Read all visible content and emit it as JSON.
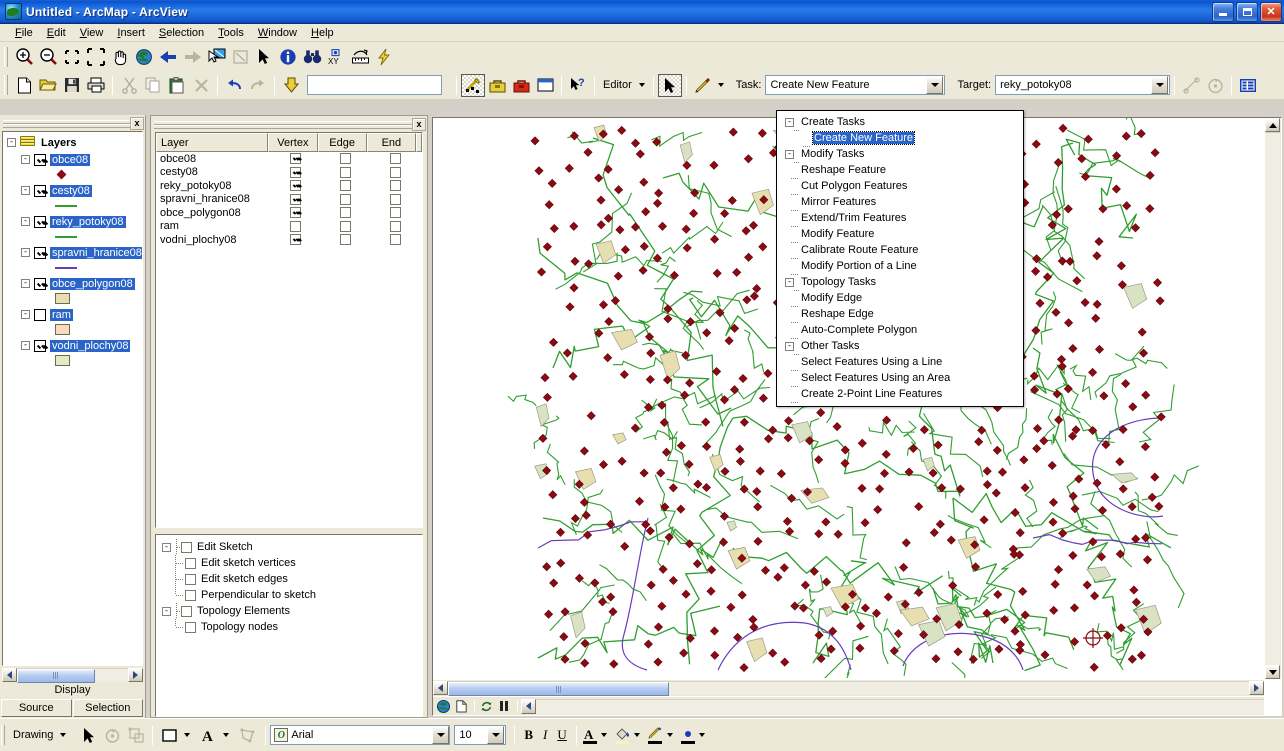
{
  "window": {
    "title": "Untitled - ArcMap - ArcView",
    "app_icon": "arcmap-globe-icon",
    "minimize": "minimize-button",
    "restore": "restore-button",
    "close": "close-button"
  },
  "menu": [
    {
      "label": "File",
      "accel": "F"
    },
    {
      "label": "Edit",
      "accel": "E"
    },
    {
      "label": "View",
      "accel": "V"
    },
    {
      "label": "Insert",
      "accel": "I"
    },
    {
      "label": "Selection",
      "accel": "S"
    },
    {
      "label": "Tools",
      "accel": "T"
    },
    {
      "label": "Window",
      "accel": "W"
    },
    {
      "label": "Help",
      "accel": "H"
    }
  ],
  "tools_toolbar": [
    {
      "name": "zoom-in-icon",
      "title": "Zoom In"
    },
    {
      "name": "zoom-out-icon",
      "title": "Zoom Out"
    },
    {
      "name": "fixed-zoom-in-icon",
      "title": "Fixed Zoom In"
    },
    {
      "name": "fixed-zoom-out-icon",
      "title": "Fixed Zoom Out"
    },
    {
      "name": "pan-hand-icon",
      "title": "Pan"
    },
    {
      "name": "full-extent-globe-icon",
      "title": "Full Extent"
    },
    {
      "name": "back-extent-icon",
      "title": "Go Back To Previous Extent"
    },
    {
      "name": "forward-extent-icon",
      "title": "Go To Next Extent"
    },
    {
      "name": "select-features-icon",
      "title": "Select Features"
    },
    {
      "name": "select-elements-icon",
      "title": "Select Elements"
    },
    {
      "name": "pointer-icon",
      "title": "Select Elements"
    },
    {
      "name": "identify-icon",
      "title": "Identify"
    },
    {
      "name": "find-binoculars-icon",
      "title": "Find"
    },
    {
      "name": "go-to-xy-icon",
      "title": "Go To XY"
    },
    {
      "name": "measure-icon",
      "title": "Measure"
    },
    {
      "name": "hyperlink-lightning-icon",
      "title": "Hyperlink"
    }
  ],
  "standard_toolbar": [
    {
      "name": "new-document-icon",
      "title": "New"
    },
    {
      "name": "open-folder-icon",
      "title": "Open"
    },
    {
      "name": "save-diskette-icon",
      "title": "Save"
    },
    {
      "name": "print-icon",
      "title": "Print"
    },
    {
      "name": "cut-scissors-icon",
      "title": "Cut"
    },
    {
      "name": "copy-icon",
      "title": "Copy"
    },
    {
      "name": "paste-clipboard-icon",
      "title": "Paste"
    },
    {
      "name": "delete-x-icon",
      "title": "Delete"
    },
    {
      "name": "undo-arrow-icon",
      "title": "Undo"
    },
    {
      "name": "redo-arrow-icon",
      "title": "Redo"
    },
    {
      "name": "add-data-icon",
      "title": "Add Data"
    }
  ],
  "scale_box": {
    "value": "",
    "placeholder": ""
  },
  "editor_toolbar": {
    "sketch_tool_icon": "sketch-tool-icon",
    "toolbox_icon": "editor-toolbox-icon",
    "toolbox_red_icon": "editor-red-toolbox-icon",
    "attributes_icon": "attributes-window-icon",
    "whats_this_icon": "whats-this-pointer-icon",
    "editor_menu_label": "Editor",
    "edit_tool_icon": "edit-pointer-icon",
    "sketch_pencil_icon": "sketch-pencil-icon",
    "task_label": "Task:",
    "task_value": "Create New Feature",
    "target_label": "Target:",
    "target_value": "reky_potoky08",
    "split_tool_icon": "split-tool-icon",
    "rotate_tool_icon": "rotate-tool-icon",
    "attribute_table_icon": "attribute-table-icon"
  },
  "task_dropdown": {
    "groups": [
      {
        "label": "Create Tasks",
        "expander": "-",
        "items": [
          {
            "label": "Create New Feature",
            "selected": true
          }
        ]
      },
      {
        "label": "Modify Tasks",
        "expander": "-",
        "items": [
          {
            "label": "Reshape Feature",
            "selected": false
          },
          {
            "label": "Cut Polygon Features",
            "selected": false
          },
          {
            "label": "Mirror Features",
            "selected": false
          },
          {
            "label": "Extend/Trim Features",
            "selected": false
          },
          {
            "label": "Modify Feature",
            "selected": false
          },
          {
            "label": "Calibrate Route Feature",
            "selected": false
          },
          {
            "label": "Modify Portion of a Line",
            "selected": false
          }
        ]
      },
      {
        "label": "Topology Tasks",
        "expander": "-",
        "items": [
          {
            "label": "Modify Edge",
            "selected": false
          },
          {
            "label": "Reshape Edge",
            "selected": false
          },
          {
            "label": "Auto-Complete Polygon",
            "selected": false
          }
        ]
      },
      {
        "label": "Other Tasks",
        "expander": "-",
        "items": [
          {
            "label": "Select Features Using a Line",
            "selected": false
          },
          {
            "label": "Select Features Using an Area",
            "selected": false
          },
          {
            "label": "Create 2-Point Line Features",
            "selected": false
          }
        ]
      }
    ]
  },
  "toc": {
    "close_label": "x",
    "root_label": "Layers",
    "root_expander": "-",
    "layers": [
      {
        "name": "obce08",
        "checked": true,
        "expander": "-",
        "symbol": {
          "kind": "diamond",
          "color": "#8b0a13"
        }
      },
      {
        "name": "cesty08",
        "checked": true,
        "expander": "-",
        "symbol": {
          "kind": "line",
          "color": "#2f9e2f"
        }
      },
      {
        "name": "reky_potoky08",
        "checked": true,
        "expander": "-",
        "symbol": {
          "kind": "line",
          "color": "#2f9e2f"
        }
      },
      {
        "name": "spravni_hranice08",
        "checked": true,
        "expander": "-",
        "symbol": {
          "kind": "line",
          "color": "#6a3bbf"
        }
      },
      {
        "name": "obce_polygon08",
        "checked": true,
        "expander": "-",
        "symbol": {
          "kind": "square",
          "color": "#e8dfb0"
        }
      },
      {
        "name": "ram",
        "checked": false,
        "expander": "-",
        "symbol": {
          "kind": "square",
          "color": "#fbd9bd"
        }
      },
      {
        "name": "vodni_plochy08",
        "checked": true,
        "expander": "-",
        "symbol": {
          "kind": "square",
          "color": "#e2ecc0"
        }
      }
    ],
    "display_label": "Display",
    "tabs": [
      {
        "label": "Source",
        "active": false
      },
      {
        "label": "Selection",
        "active": false
      }
    ]
  },
  "snapping_window": {
    "close_label": "x",
    "columns": [
      "Layer",
      "Vertex",
      "Edge",
      "End"
    ],
    "rows": [
      {
        "layer": "obce08",
        "vertex": true,
        "edge": false,
        "end": false
      },
      {
        "layer": "cesty08",
        "vertex": true,
        "edge": false,
        "end": false
      },
      {
        "layer": "reky_potoky08",
        "vertex": true,
        "edge": false,
        "end": false
      },
      {
        "layer": "spravni_hranice08",
        "vertex": true,
        "edge": false,
        "end": false
      },
      {
        "layer": "obce_polygon08",
        "vertex": true,
        "edge": false,
        "end": false
      },
      {
        "layer": "ram",
        "vertex": false,
        "edge": false,
        "end": false
      },
      {
        "layer": "vodni_plochy08",
        "vertex": true,
        "edge": false,
        "end": false
      }
    ],
    "tree": [
      {
        "label": "Edit Sketch",
        "level": 0,
        "checked": false,
        "expander": "-"
      },
      {
        "label": "Edit sketch vertices",
        "level": 1,
        "checked": false
      },
      {
        "label": "Edit sketch edges",
        "level": 1,
        "checked": false
      },
      {
        "label": "Perpendicular to sketch",
        "level": 1,
        "checked": false
      },
      {
        "label": "Topology Elements",
        "level": 0,
        "checked": false,
        "expander": "-"
      },
      {
        "label": "Topology nodes",
        "level": 1,
        "checked": false
      }
    ]
  },
  "map_view": {
    "bottom_icons": [
      {
        "name": "data-view-globe-icon"
      },
      {
        "name": "layout-view-page-icon"
      },
      {
        "name": "refresh-icon"
      },
      {
        "name": "pause-drawing-icon"
      }
    ]
  },
  "draw_toolbar": {
    "menu_label": "Drawing",
    "select_icon": "select-elements-icon",
    "rotate_icon": "rotate-element-icon",
    "group_icon": "group-elements-icon",
    "shape_icon": "new-rectangle-icon",
    "text_icon": "new-text-icon",
    "nudge_icon": "edit-vertices-icon",
    "font_name": "Arial",
    "font_size": "10",
    "bold_label": "B",
    "italic_label": "I",
    "underline_label": "U",
    "font_color_icon": "font-color-icon",
    "fill_color_icon": "fill-color-icon",
    "line_color_icon": "line-color-icon",
    "marker_color_icon": "marker-color-icon"
  },
  "colors": {
    "title_blue": "#1256cf",
    "face": "#ece9d8",
    "highlight_blue": "#2a64c8",
    "point_red": "#8b0a13",
    "stream_green": "#2f9e2f",
    "boundary_purple": "#6a3bbf",
    "polygon_tan": "#e8dfb0"
  }
}
